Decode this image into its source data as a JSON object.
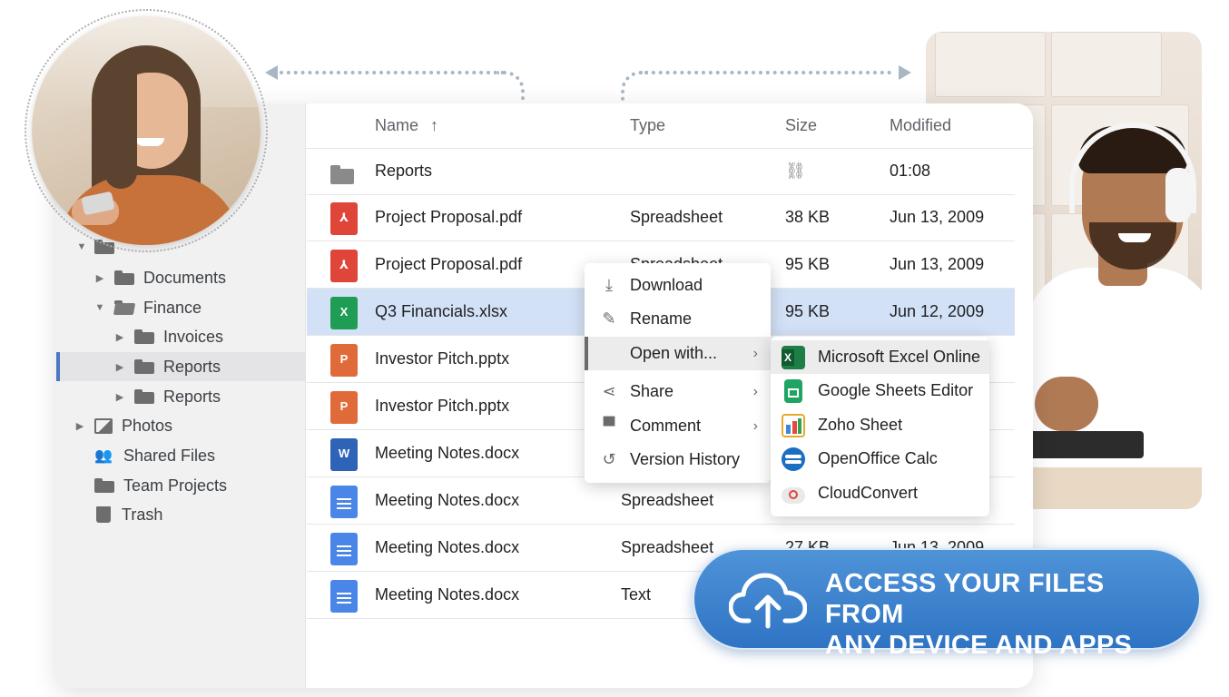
{
  "sidebar": {
    "items": [
      {
        "label": "Documents"
      },
      {
        "label": "Finance"
      },
      {
        "label": "Invoices"
      },
      {
        "label": "Reports"
      },
      {
        "label": "Reports"
      },
      {
        "label": "Photos"
      },
      {
        "label": "Shared Files"
      },
      {
        "label": "Team Projects"
      },
      {
        "label": "Trash"
      }
    ]
  },
  "columns": {
    "name": "Name",
    "sort_indicator": "↑",
    "type": "Type",
    "size": "Size",
    "modified": "Modified"
  },
  "files": [
    {
      "name": "Reports",
      "type": "",
      "size": "",
      "modified": "01:08",
      "icon": "folder-icon"
    },
    {
      "name": "Project Proposal.pdf",
      "type": "Spreadsheet",
      "size": "38 KB",
      "modified": "Jun 13, 2009",
      "icon": "pdf-icon"
    },
    {
      "name": "Project Proposal.pdf",
      "type": "Spreadsheet",
      "size": "95 KB",
      "modified": "Jun 13, 2009",
      "icon": "pdf-icon"
    },
    {
      "name": "Q3 Financials.xlsx",
      "type": "",
      "size": "95 KB",
      "modified": "Jun 12, 2009",
      "icon": "excel-icon"
    },
    {
      "name": "Investor Pitch.pptx",
      "type": "",
      "size": "",
      "modified": "",
      "icon": "powerpoint-icon"
    },
    {
      "name": "Investor Pitch.pptx",
      "type": "",
      "size": "",
      "modified": "",
      "icon": "powerpoint-icon"
    },
    {
      "name": "Meeting Notes.docx",
      "type": "",
      "size": "",
      "modified": "",
      "icon": "word-icon"
    },
    {
      "name": "Meeting Notes.docx",
      "type": "Spreadsheet",
      "size": "",
      "modified": "",
      "icon": "google-doc-icon"
    },
    {
      "name": "Meeting Notes.docx",
      "type": "Spreadsheet",
      "size": "27 KB",
      "modified": "Jun 13, 2009",
      "icon": "google-doc-icon"
    },
    {
      "name": "Meeting Notes.docx",
      "type": "Text",
      "size": "",
      "modified": "",
      "icon": "google-doc-icon"
    }
  ],
  "context_menu": {
    "items": [
      {
        "label": "Download",
        "icon": "download-icon"
      },
      {
        "label": "Rename",
        "icon": "pencil-icon"
      },
      {
        "label": "Open with...",
        "icon": ""
      },
      {
        "label": "Share",
        "icon": "share-icon"
      },
      {
        "label": "Comment",
        "icon": "comment-icon"
      },
      {
        "label": "Version History",
        "icon": "history-icon"
      }
    ],
    "chevron": "›"
  },
  "open_with_menu": {
    "items": [
      {
        "label": "Microsoft Excel Online",
        "icon": "excel-online-icon"
      },
      {
        "label": "Google Sheets Editor",
        "icon": "google-sheets-icon"
      },
      {
        "label": "Zoho Sheet",
        "icon": "zoho-sheet-icon"
      },
      {
        "label": "OpenOffice Calc",
        "icon": "openoffice-calc-icon"
      },
      {
        "label": "CloudConvert",
        "icon": "cloudconvert-icon"
      }
    ]
  },
  "banner": {
    "line1": "ACCESS YOUR FILES FROM",
    "line2": "ANY DEVICE AND APPS",
    "icon": "cloud-upload-icon"
  },
  "colors": {
    "accent": "#4a78c4",
    "selection": "#d3e1f6",
    "banner": "#3a80cc"
  }
}
